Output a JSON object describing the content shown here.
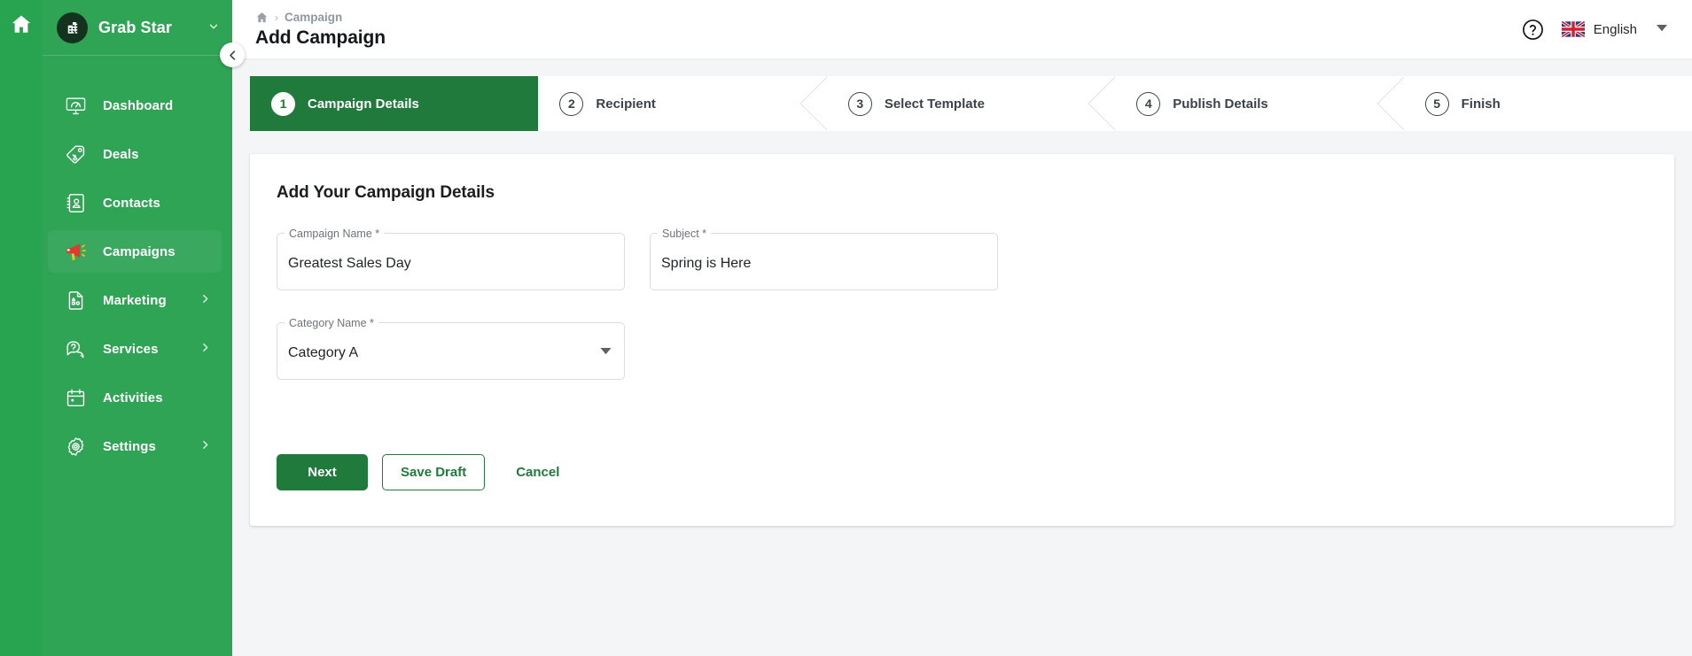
{
  "rail": {
    "home_icon": "home-icon"
  },
  "sidebar": {
    "brand": {
      "name": "Grab Star",
      "logo_icon": "building-icon",
      "caret_icon": "chevron-down-icon"
    },
    "collapse_icon": "chevron-left-icon",
    "items": [
      {
        "label": "Dashboard",
        "icon": "dashboard-monitor-icon",
        "active": false,
        "has_arrow": false
      },
      {
        "label": "Deals",
        "icon": "price-tag-icon",
        "active": false,
        "has_arrow": false
      },
      {
        "label": "Contacts",
        "icon": "contact-book-icon",
        "active": false,
        "has_arrow": false
      },
      {
        "label": "Campaigns",
        "icon": "megaphone-icon",
        "active": true,
        "has_arrow": false
      },
      {
        "label": "Marketing",
        "icon": "document-shapes-icon",
        "active": false,
        "has_arrow": true
      },
      {
        "label": "Services",
        "icon": "question-chat-icon",
        "active": false,
        "has_arrow": true
      },
      {
        "label": "Activities",
        "icon": "calendar-icon",
        "active": false,
        "has_arrow": false
      },
      {
        "label": "Settings",
        "icon": "gear-icon",
        "active": false,
        "has_arrow": true
      }
    ]
  },
  "topbar": {
    "breadcrumb": {
      "home_icon": "home-icon",
      "separator": "›",
      "text": "Campaign"
    },
    "title": "Add Campaign",
    "help_icon": "help-circle-icon",
    "language": {
      "label": "English",
      "flag": "uk-flag-icon",
      "caret_icon": "caret-down-icon"
    }
  },
  "stepper": {
    "steps": [
      {
        "num": "1",
        "label": "Campaign Details",
        "active": true
      },
      {
        "num": "2",
        "label": "Recipient",
        "active": false
      },
      {
        "num": "3",
        "label": "Select Template",
        "active": false
      },
      {
        "num": "4",
        "label": "Publish Details",
        "active": false
      },
      {
        "num": "5",
        "label": "Finish",
        "active": false
      }
    ]
  },
  "form": {
    "heading": "Add Your Campaign Details",
    "fields": {
      "campaign_name": {
        "label": "Campaign Name *",
        "value": "Greatest Sales Day"
      },
      "subject": {
        "label": "Subject *",
        "value": "Spring is Here"
      },
      "category": {
        "label": "Category Name *",
        "value": "Category A",
        "caret_icon": "dropdown-arrow-icon"
      }
    },
    "buttons": {
      "next": "Next",
      "save_draft": "Save Draft",
      "cancel": "Cancel"
    }
  },
  "colors": {
    "brand_green": "#30a455",
    "rail_green": "#28a34f",
    "active_item_green": "#3aa95f",
    "dark_green": "#207a3c",
    "page_bg": "#f4f5f6",
    "accent_red": "#e03a2f"
  }
}
